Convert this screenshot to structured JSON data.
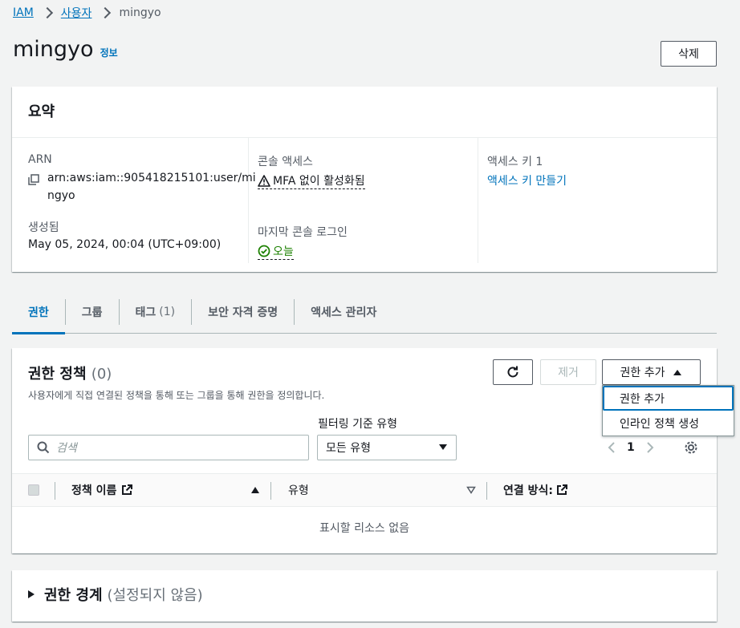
{
  "breadcrumb": {
    "root": "IAM",
    "section": "사용자",
    "current": "mingyo"
  },
  "header": {
    "title": "mingyo",
    "info": "정보",
    "delete_label": "삭제"
  },
  "summary": {
    "title": "요약",
    "arn_label": "ARN",
    "arn_value_line1": "arn:aws:iam::905418215101:user/mi",
    "arn_value_line2": "ngyo",
    "created_label": "생성됨",
    "created_value": "May 05, 2024, 00:04 (UTC+09:00)",
    "console_access_label": "콘솔 액세스",
    "console_access_value": "MFA 없이 활성화됨",
    "last_login_label": "마지막 콘솔 로그인",
    "last_login_value": "오늘",
    "access_key_label": "액세스 키 1",
    "access_key_link": "액세스 키 만들기"
  },
  "tabs": [
    {
      "label": "권한"
    },
    {
      "label": "그룹"
    },
    {
      "label": "태그",
      "count": "(1)"
    },
    {
      "label": "보안 자격 증명"
    },
    {
      "label": "액세스 관리자"
    }
  ],
  "permissions": {
    "title": "권한 정책",
    "count": "(0)",
    "description": "사용자에게 직접 연결된 정책을 통해 또는 그룹을 통해 권한을 정의합니다.",
    "remove_label": "제거",
    "add_label": "권한 추가",
    "dropdown": [
      "권한 추가",
      "인라인 정책 생성"
    ],
    "filter_label": "필터링 기준 유형",
    "search_placeholder": "검색",
    "filter_value": "모든 유형",
    "page": "1",
    "columns": {
      "policy_name": "정책 이름",
      "type": "유형",
      "attached_via": "연결 방식:"
    },
    "empty_text": "표시할 리소스 없음"
  },
  "boundary": {
    "title": "권한 경계",
    "status": "(설정되지 않음)"
  },
  "colors": {
    "link": "#0073bb",
    "success": "#1d8102",
    "warning": "#ff9900"
  }
}
